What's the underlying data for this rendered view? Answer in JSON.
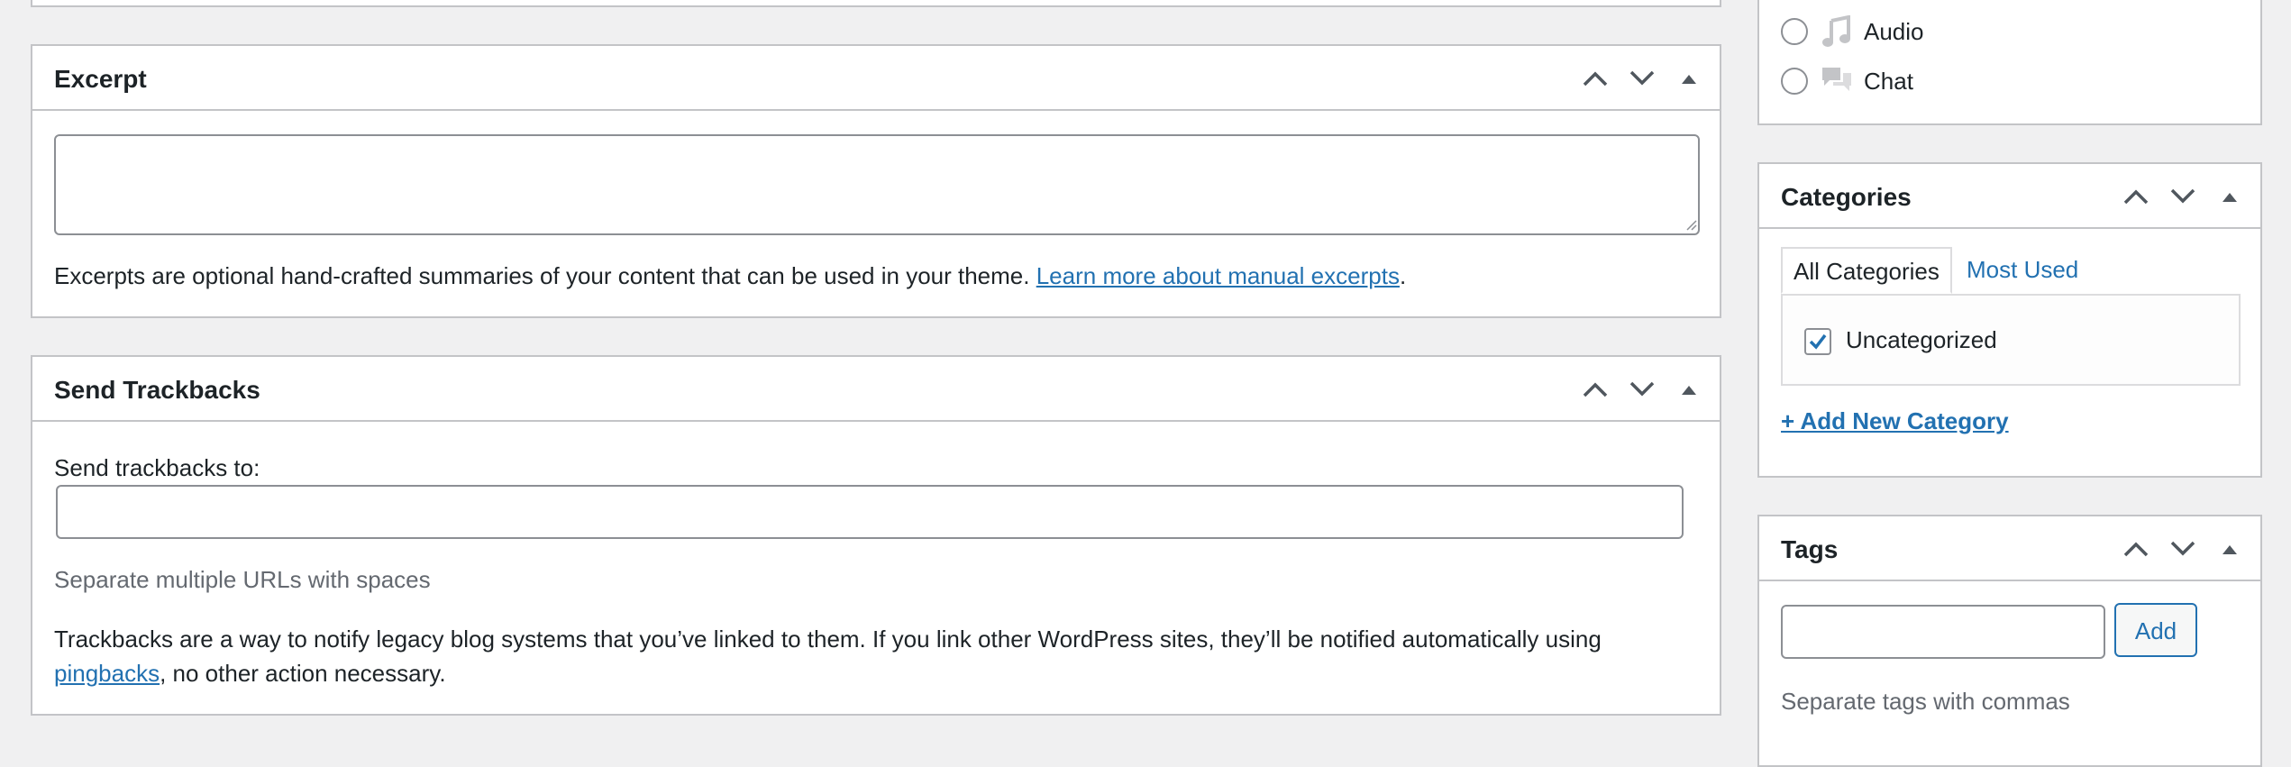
{
  "excerpt": {
    "title": "Excerpt",
    "value": "",
    "description": "Excerpts are optional hand-crafted summaries of your content that can be used in your theme.",
    "link_text": "Learn more about manual excerpts",
    "trailing": "."
  },
  "trackbacks": {
    "title": "Send Trackbacks",
    "field_label": "Send trackbacks to:",
    "value": "",
    "help": "Separate multiple URLs with spaces",
    "description_line1": "Trackbacks are a way to notify legacy blog systems that you’ve linked to them. If you link other WordPress sites, they’ll be notified automatically using",
    "link_text": "pingbacks",
    "description_line2_rest": ", no other action necessary."
  },
  "format": {
    "options": [
      {
        "label": "Audio",
        "icon": "music-note-icon",
        "selected": false
      },
      {
        "label": "Chat",
        "icon": "chat-bubbles-icon",
        "selected": false
      }
    ]
  },
  "categories": {
    "title": "Categories",
    "tabs": [
      "All Categories",
      "Most Used"
    ],
    "active_tab": "All Categories",
    "items": [
      {
        "label": "Uncategorized",
        "checked": true
      }
    ],
    "add_link": "+ Add New Category"
  },
  "tags": {
    "title": "Tags",
    "value": "",
    "add_button": "Add",
    "help": "Separate tags with commas"
  },
  "colors": {
    "link": "#2271b1",
    "border": "#c3c4c7",
    "background": "#f0f0f1",
    "text": "#1d2327",
    "muted": "#646970"
  }
}
